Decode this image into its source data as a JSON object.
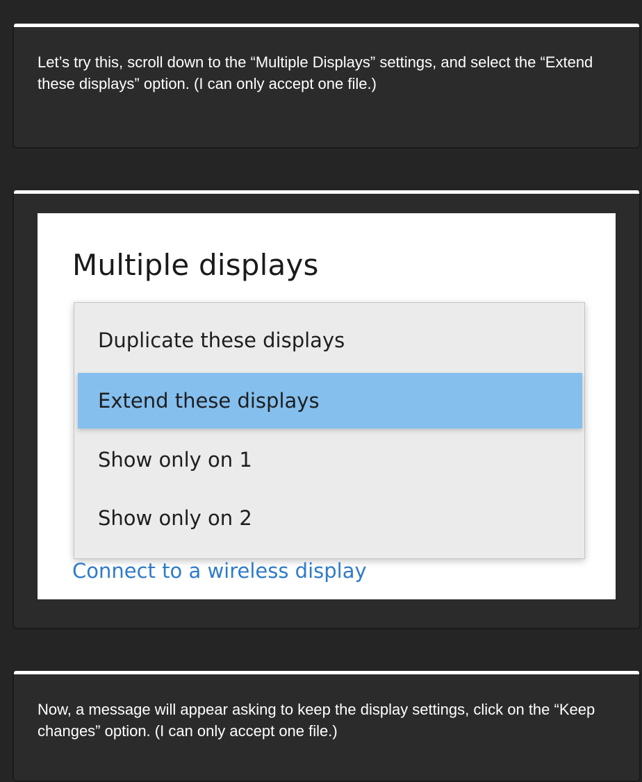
{
  "messages": [
    {
      "text": "Let’s try this, scroll down to the “Multiple Displays” settings, and select the “Extend these displays” option. (I can only accept one file.)"
    },
    {
      "screenshot": {
        "title": "Multiple displays",
        "dropdown_options": [
          "Duplicate these displays",
          "Extend these displays",
          "Show only on 1",
          "Show only on 2"
        ],
        "selected_option": "Extend these displays",
        "link": "Connect to a wireless display",
        "highlight_color": "#84bfee",
        "link_color": "#2f7bc8"
      }
    },
    {
      "text": "Now, a message will appear asking to keep the display settings, click on the “Keep changes” option. (I can only accept one file.)"
    }
  ]
}
